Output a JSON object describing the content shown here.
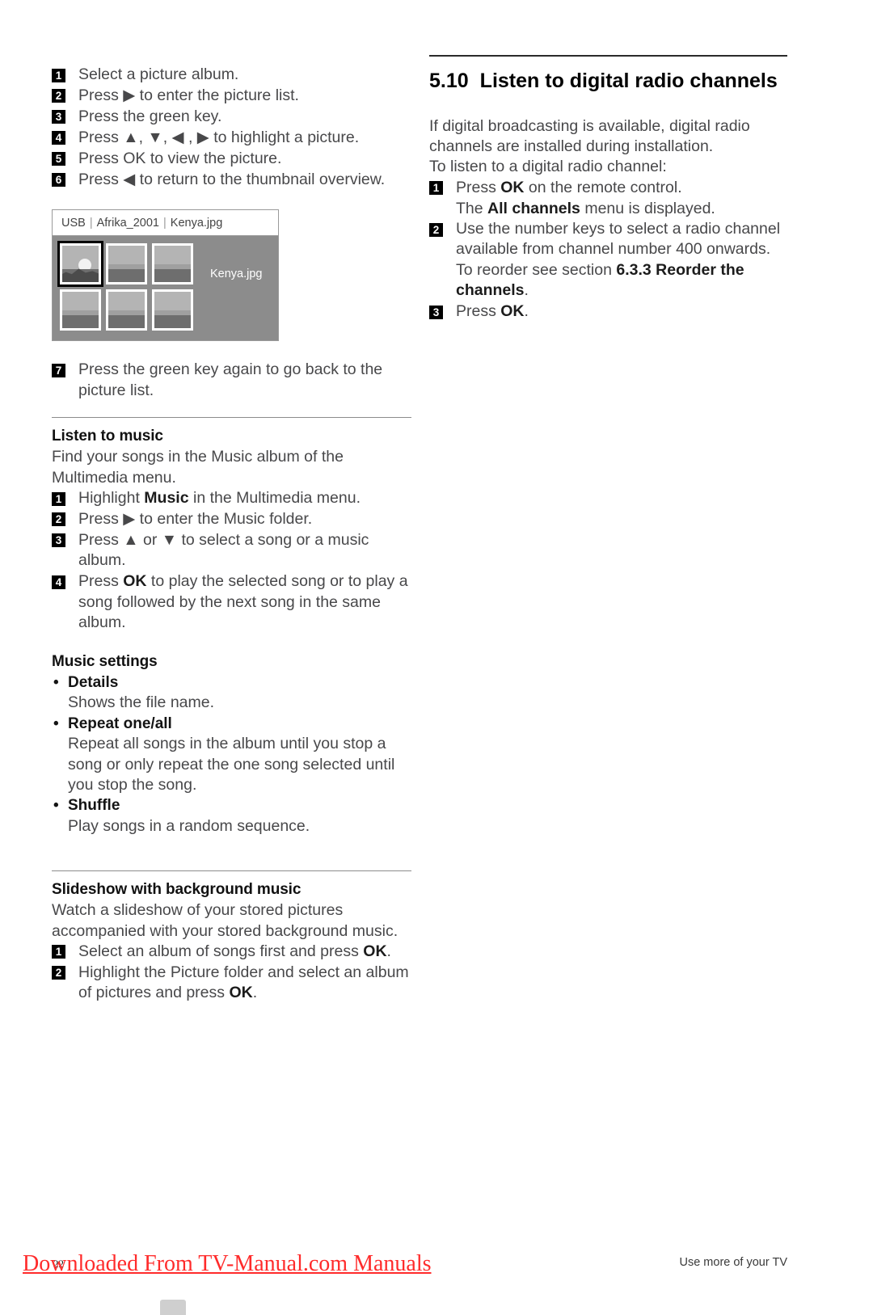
{
  "document": {
    "page_number": "22",
    "footer_right": "Use more of your TV",
    "watermark": "Downloaded From TV-Manual.com Manuals",
    "watermark_color": "#ff2b2b"
  },
  "left_column": {
    "picture_steps": [
      {
        "num": "1",
        "text": "Select a picture album."
      },
      {
        "num": "2",
        "text": "Press ▶ to enter the picture list."
      },
      {
        "num": "3",
        "text": "Press the green key."
      },
      {
        "num": "4",
        "text": "Press ▲, ▼, ◀ , ▶ to highlight a picture."
      },
      {
        "num": "5",
        "text": "Press OK to view the picture."
      },
      {
        "num": "6",
        "text": "Press ◀ to return to the thumbnail overview."
      }
    ],
    "figure": {
      "breadcrumb": [
        "USB",
        "Afrika_2001",
        "Kenya.jpg"
      ],
      "separator": "|",
      "caption": "Kenya.jpg",
      "thumbnail_count": 6,
      "selected_index": 0
    },
    "step_seven": {
      "num": "7",
      "text": "Press the green key again to go back to the picture list."
    },
    "listen_to_music": {
      "heading": "Listen to music",
      "intro": "Find your songs in the Music album of the Multimedia menu.",
      "steps": [
        {
          "num": "1",
          "pre": "Highlight ",
          "bold": "Music",
          "post": " in the Multimedia menu."
        },
        {
          "num": "2",
          "pre": "Press ▶ to enter the Music folder.",
          "bold": "",
          "post": ""
        },
        {
          "num": "3",
          "pre": "Press ▲ or ▼ to select a song or a music album.",
          "bold": "",
          "post": ""
        },
        {
          "num": "4",
          "pre": "Press ",
          "bold": "OK",
          "post": " to play the selected song or to play a song followed by the next song in the same album."
        }
      ]
    },
    "music_settings": {
      "heading": "Music settings",
      "items": [
        {
          "term": "Details",
          "desc": "Shows the file name."
        },
        {
          "term": "Repeat one/all",
          "desc": "Repeat all songs in the album until you stop a song or only repeat the one song selected until you stop the song."
        },
        {
          "term": "Shuffle",
          "desc": "Play songs in a random sequence."
        }
      ]
    },
    "slideshow": {
      "heading": "Slideshow with background music",
      "intro": "Watch a slideshow of your stored pictures accompanied with your stored background music.",
      "steps": [
        {
          "num": "1",
          "pre": "Select an album of songs first and press ",
          "bold": "OK",
          "post": "."
        },
        {
          "num": "2",
          "pre": "Highlight the Picture folder and select an album of pictures and press ",
          "bold": "OK",
          "post": "."
        }
      ]
    }
  },
  "right_column": {
    "section_number": "5.10",
    "section_title": "Listen to digital radio channels",
    "intro_line1": "If digital broadcasting is available, digital radio channels are installed during installation.",
    "intro_line2": "To listen to a digital radio channel:",
    "steps": [
      {
        "num": "1",
        "pre": "Press ",
        "bold": "OK",
        "post": " on the remote control."
      },
      {
        "num": "2",
        "pre": "Use the number keys to select a radio channel available from channel number 400 onwards. To reorder see section ",
        "bold": "6.3.3 Reorder the channels",
        "post": "."
      },
      {
        "num": "3",
        "pre": "Press ",
        "bold": "OK",
        "post": "."
      }
    ],
    "step1_sub_pre": "The ",
    "step1_sub_bold": "All channels",
    "step1_sub_post": " menu is displayed."
  }
}
